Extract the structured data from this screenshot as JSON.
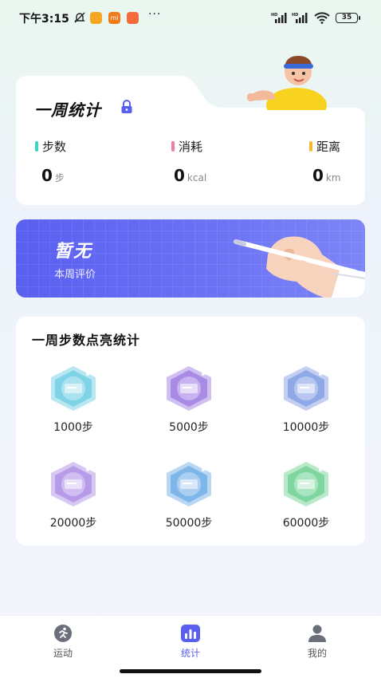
{
  "status_bar": {
    "time": "下午3:15",
    "app_badge_2": "mi",
    "dots": "···",
    "signal_1_tag": "HD",
    "signal_2_tag": "HD",
    "battery": "35"
  },
  "week_stats": {
    "title": "一周统计",
    "metrics": [
      {
        "label": "步数",
        "value": "0",
        "unit": "步",
        "color": "#3dd6c3"
      },
      {
        "label": "消耗",
        "value": "0",
        "unit": "kcal",
        "color": "#f07aa8"
      },
      {
        "label": "距离",
        "value": "0",
        "unit": "km",
        "color": "#f5b82e"
      }
    ]
  },
  "evaluation": {
    "title": "暂无",
    "subtitle": "本周评价"
  },
  "badges": {
    "title": "一周步数点亮统计",
    "items": [
      {
        "label": "1000步",
        "color": "#7fd3e6"
      },
      {
        "label": "5000步",
        "color": "#a98be6"
      },
      {
        "label": "10000步",
        "color": "#8fa8e6"
      },
      {
        "label": "20000步",
        "color": "#b79be8"
      },
      {
        "label": "50000步",
        "color": "#7fb6ea"
      },
      {
        "label": "60000步",
        "color": "#7fd69e"
      }
    ]
  },
  "tabs": [
    {
      "label": "运动",
      "active": false
    },
    {
      "label": "统计",
      "active": true
    },
    {
      "label": "我的",
      "active": false
    }
  ],
  "colors": {
    "accent": "#5a5ff0"
  }
}
